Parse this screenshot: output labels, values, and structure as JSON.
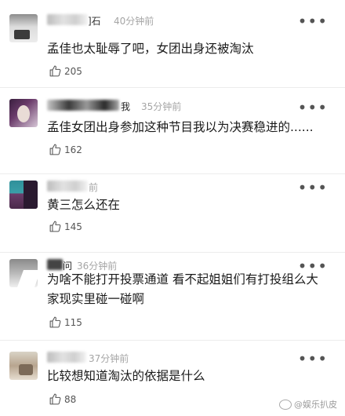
{
  "comments": [
    {
      "name_fragment": "]石",
      "time": "40分钟前",
      "text": "孟佳也太耻辱了吧，女团出身还被淘汰",
      "likes": "205"
    },
    {
      "name_fragment": "我",
      "time": "35分钟前",
      "text": "孟佳女团出身参加这种节目我以为决赛稳进的......",
      "likes": "162"
    },
    {
      "name_fragment": "",
      "time": "前",
      "text": "黄三怎么还在",
      "likes": "145"
    },
    {
      "name_fragment": "问",
      "time": "36分钟前",
      "text": "为啥不能打开投票通道 看不起姐姐们有打投组么大家现实里碰一碰啊",
      "likes": "115"
    },
    {
      "name_fragment": "",
      "time": "37分钟前",
      "text": "比较想知道淘汰的依据是什么",
      "likes": "88"
    }
  ],
  "more_glyph": "•••",
  "watermark": "@娱乐扒皮",
  "icons": {
    "like": "thumb-up-icon",
    "more": "more-dots-icon",
    "watermark": "weibo-icon"
  }
}
